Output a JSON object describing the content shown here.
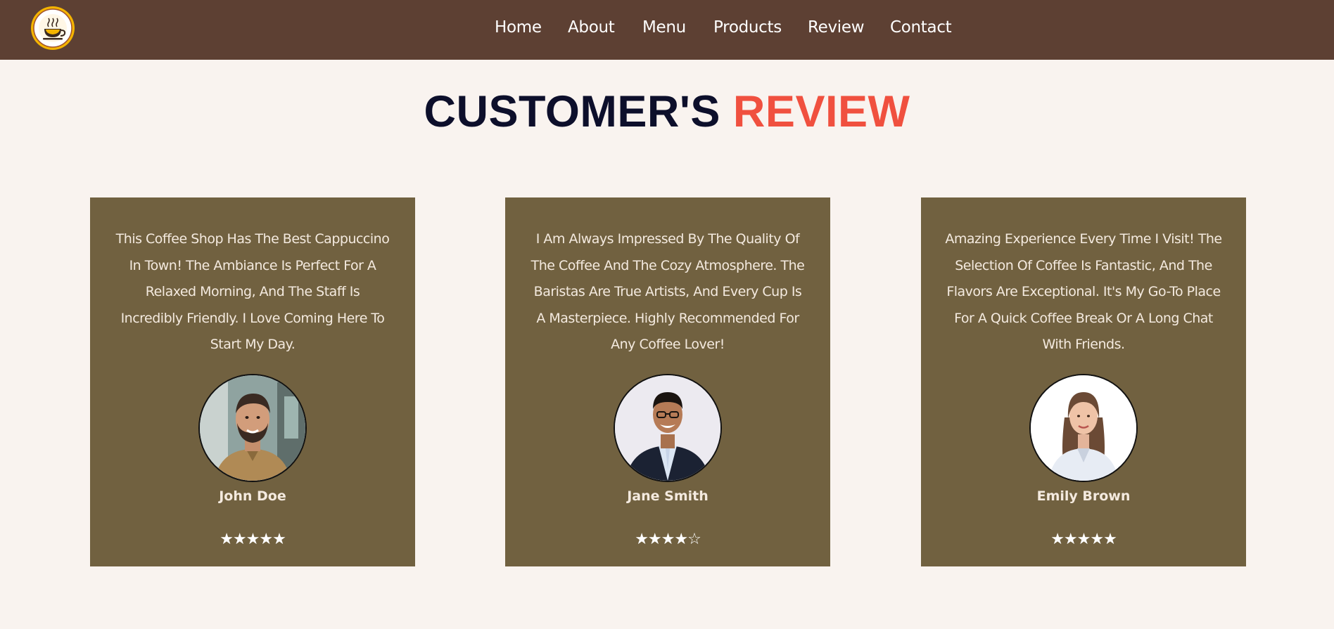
{
  "nav": {
    "logo_icon": "coffee-cup-logo-icon",
    "items": [
      {
        "label": "Home"
      },
      {
        "label": "About"
      },
      {
        "label": "Menu"
      },
      {
        "label": "Products"
      },
      {
        "label": "Review"
      },
      {
        "label": "Contact"
      }
    ]
  },
  "heading": {
    "part1": "CUSTOMER'S",
    "part2": "REVIEW"
  },
  "colors": {
    "header_bg": "#5d4033",
    "page_bg": "#f9f3ef",
    "card_bg": "#716140",
    "accent": "#f0503f",
    "heading_dark": "#0d0f2b"
  },
  "reviews": [
    {
      "text": "This Coffee Shop Has The Best Cappuccino In Town! The Ambiance Is Perfect For A Relaxed Morning, And The Staff Is Incredibly Friendly. I Love Coming Here To Start My Day.",
      "name": "John Doe",
      "stars": "★★★★★",
      "rating": 5
    },
    {
      "text": "I Am Always Impressed By The Quality Of The Coffee And The Cozy Atmosphere. The Baristas Are True Artists, And Every Cup Is A Masterpiece. Highly Recommended For Any Coffee Lover!",
      "name": "Jane Smith",
      "stars": "★★★★☆",
      "rating": 4
    },
    {
      "text": "Amazing Experience Every Time I Visit! The Selection Of Coffee Is Fantastic, And The Flavors Are Exceptional. It's My Go-To Place For A Quick Coffee Break Or A Long Chat With Friends.",
      "name": "Emily Brown",
      "stars": "★★★★★",
      "rating": 5
    }
  ]
}
